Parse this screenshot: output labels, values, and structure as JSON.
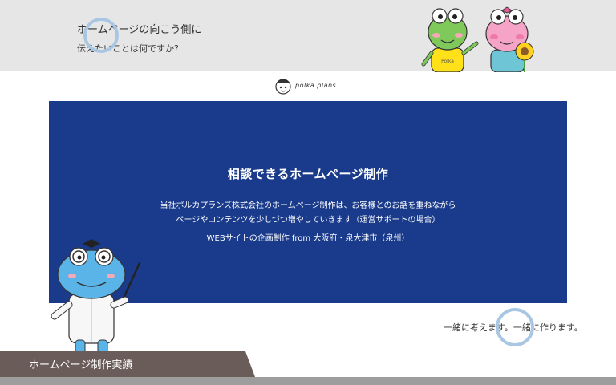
{
  "header": {
    "tagline_line1": "ホームページの向こう側に",
    "tagline_line2": "伝えたいことは何ですか?",
    "mascot_shirt_label": "Polka"
  },
  "logo": {
    "text": "polka plans"
  },
  "hero": {
    "title": "相談できるホームページ制作",
    "description_lines": [
      "当社ポルカプランズ株式会社のホームページ制作は、お客様とのお話を重ねながら",
      "ページやコンテンツを少しづつ増やしていきます（運営サポートの場合）"
    ],
    "location": "WEBサイトの企画制作 from 大阪府・泉大津市（泉州）",
    "background_color": "#1a3b8b"
  },
  "together_text": "一緒に考えます。一緒に作ります。",
  "works_section": {
    "title": "ホームページ制作実績",
    "background_color": "#6a5c58"
  },
  "colors": {
    "top_band": "#e6e6e6",
    "ring": "#a9c7e2",
    "bottom_bar": "#9d9d9d"
  },
  "icons": [
    "green-frog-mascot-icon",
    "pink-frog-mascot-icon",
    "sunflower-icon",
    "professor-frog-mascot-icon",
    "pointer-stick-icon",
    "logo-face-icon"
  ]
}
